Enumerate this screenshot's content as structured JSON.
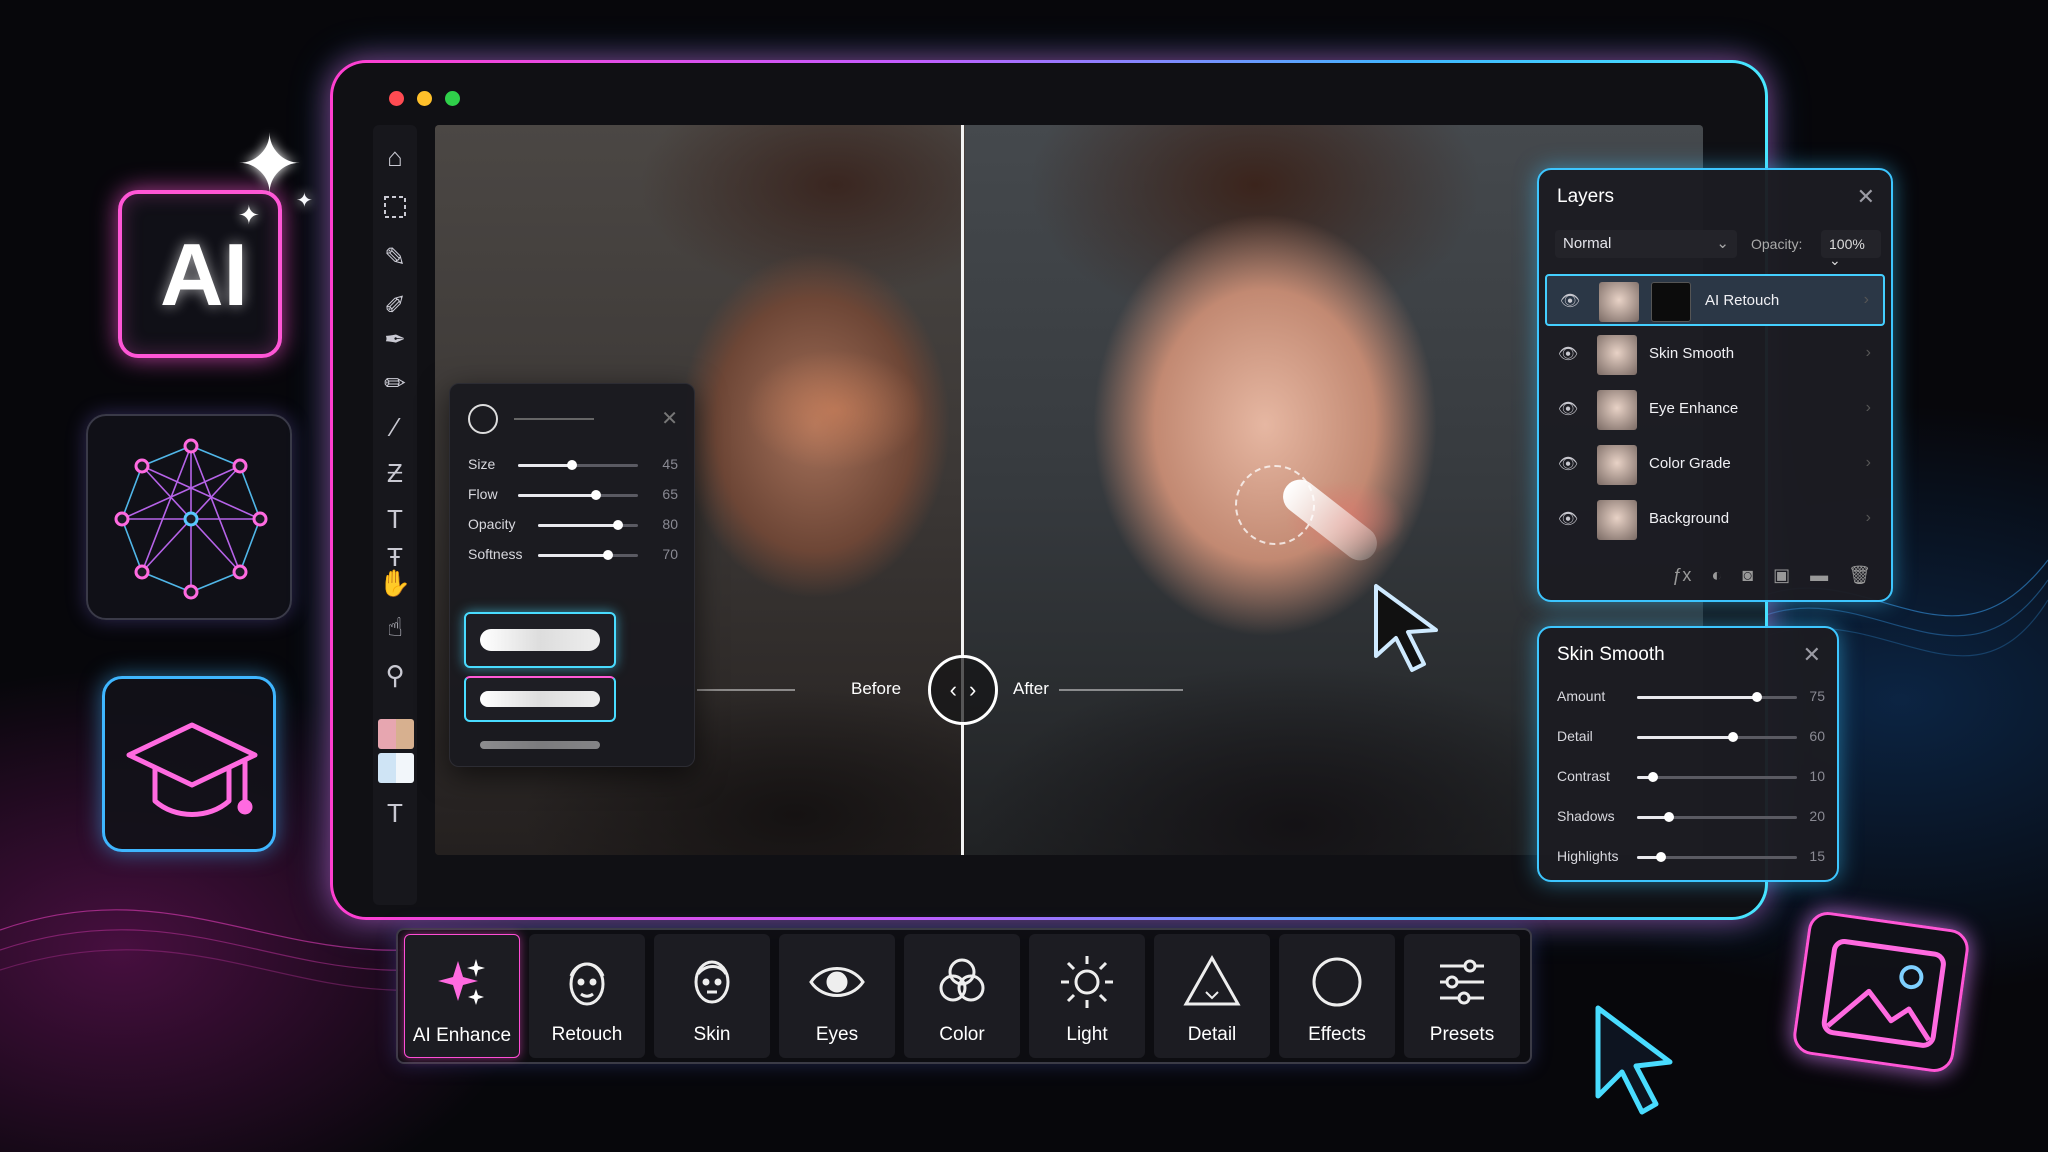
{
  "window": {
    "traffic_lights": [
      "red",
      "yellow",
      "green"
    ]
  },
  "toolbar": {
    "tools": [
      "home-icon",
      "marquee-icon",
      "brush-icon",
      "healing-icon",
      "clone-stamp-icon",
      "pencil-icon",
      "eyedropper-icon",
      "transform-icon",
      "text-icon",
      "text-icon",
      "hand-icon",
      "lasso-icon",
      "zoom-icon",
      "text-icon"
    ],
    "swatch_colors": [
      "#e7a6b0",
      "#cfe4f5"
    ]
  },
  "canvas": {
    "compare": {
      "before_label": "Before",
      "after_label": "After"
    }
  },
  "brush_panel": {
    "sliders": [
      {
        "label": "Size",
        "value": "45",
        "pct": 0.45
      },
      {
        "label": "Flow",
        "value": "65",
        "pct": 0.65
      },
      {
        "label": "Opacity",
        "value": "80",
        "pct": 0.8
      },
      {
        "label": "Softness",
        "value": "70",
        "pct": 0.7
      }
    ]
  },
  "layers_panel": {
    "title": "Layers",
    "blend_mode": "Normal",
    "opacity_label": "Opacity:",
    "opacity_value": "100%",
    "layers": [
      {
        "name": "AI Retouch",
        "active": true
      },
      {
        "name": "Skin Smooth",
        "active": false
      },
      {
        "name": "Eye Enhance",
        "active": false
      },
      {
        "name": "Color Grade",
        "active": false
      },
      {
        "name": "Background",
        "active": false
      }
    ],
    "footer_icons": [
      "fx-icon",
      "adjustment-icon",
      "mask-icon",
      "new-layer-icon",
      "folder-icon",
      "trash-icon"
    ]
  },
  "skin_panel": {
    "title": "Skin Smooth",
    "sliders": [
      {
        "label": "Amount",
        "value": "75",
        "pct": 0.75
      },
      {
        "label": "Detail",
        "value": "60",
        "pct": 0.6
      },
      {
        "label": "Contrast",
        "value": "10",
        "pct": 0.1
      },
      {
        "label": "Shadows",
        "value": "20",
        "pct": 0.2
      },
      {
        "label": "Highlights",
        "value": "15",
        "pct": 0.15
      }
    ]
  },
  "dock": {
    "buttons": [
      {
        "label": "AI Enhance",
        "icon": "sparkles-icon"
      },
      {
        "label": "Retouch",
        "icon": "face-retouch-icon"
      },
      {
        "label": "Skin",
        "icon": "face-skin-icon"
      },
      {
        "label": "Eyes",
        "icon": "eye-icon"
      },
      {
        "label": "Color",
        "icon": "color-circles-icon"
      },
      {
        "label": "Light",
        "icon": "sun-icon"
      },
      {
        "label": "Detail",
        "icon": "triangle-icon"
      },
      {
        "label": "Effects",
        "icon": "circle-icon"
      },
      {
        "label": "Presets",
        "icon": "sliders-icon"
      }
    ]
  },
  "side_tiles": {
    "ai_badge": "AI"
  },
  "colors": {
    "accent_pink": "#ff56d6",
    "accent_cyan": "#3fc6ff",
    "panel_bg": "#1c1c22"
  }
}
